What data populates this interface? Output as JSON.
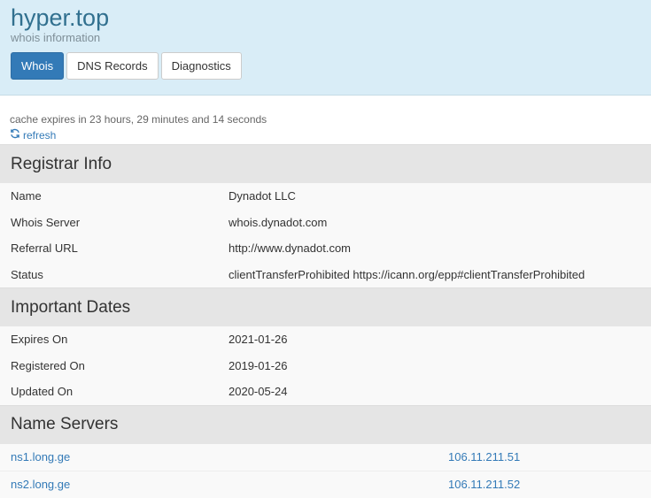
{
  "header": {
    "title": "hyper.top",
    "subtitle": "whois information",
    "tabs": [
      {
        "label": "Whois",
        "active": true
      },
      {
        "label": "DNS Records",
        "active": false
      },
      {
        "label": "Diagnostics",
        "active": false
      }
    ]
  },
  "cache": {
    "text": "cache expires in 23 hours, 29 minutes and 14 seconds",
    "refresh_label": "refresh",
    "refresh_icon": "refresh-icon"
  },
  "registrar": {
    "heading": "Registrar Info",
    "rows": [
      {
        "key": "Name",
        "value": "Dynadot LLC"
      },
      {
        "key": "Whois Server",
        "value": "whois.dynadot.com"
      },
      {
        "key": "Referral URL",
        "value": "http://www.dynadot.com"
      },
      {
        "key": "Status",
        "value": "clientTransferProhibited https://icann.org/epp#clientTransferProhibited"
      }
    ]
  },
  "dates": {
    "heading": "Important Dates",
    "rows": [
      {
        "key": "Expires On",
        "value": "2021-01-26"
      },
      {
        "key": "Registered On",
        "value": "2019-01-26"
      },
      {
        "key": "Updated On",
        "value": "2020-05-24"
      }
    ]
  },
  "nameservers": {
    "heading": "Name Servers",
    "rows": [
      {
        "host": "ns1.long.ge",
        "ip": "106.11.211.51"
      },
      {
        "host": "ns2.long.ge",
        "ip": "106.11.211.52"
      }
    ]
  },
  "colors": {
    "header_bg": "#d9edf7",
    "title": "#31708f",
    "accent": "#337ab7",
    "section_bg": "#e5e5e5",
    "row_bg": "#f9f9f9"
  }
}
